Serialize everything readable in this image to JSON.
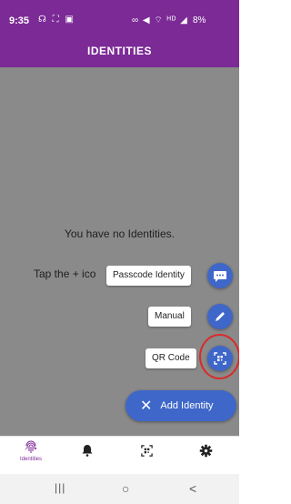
{
  "status_bar": {
    "time": "9:35",
    "left_icons": "☊ ⛶ ▣",
    "right_icons": "∞ ◀ ⌔ ᴴᴰ ◢",
    "battery": "8%"
  },
  "app_bar": {
    "title": "IDENTITIES"
  },
  "content": {
    "empty_title": "You have no Identities.",
    "empty_hint": "Tap the + ico"
  },
  "speed_dial": {
    "actions": [
      {
        "label": "Passcode Identity",
        "icon": "chat-bubble-icon"
      },
      {
        "label": "Manual",
        "icon": "pencil-icon"
      },
      {
        "label": "QR Code",
        "icon": "qr-scan-icon"
      }
    ],
    "main_label": "Add Identity",
    "main_icon": "close-icon"
  },
  "bottom_nav": {
    "items": [
      {
        "label": "Identities",
        "icon": "fingerprint-icon",
        "active": true
      },
      {
        "label": "",
        "icon": "bell-icon"
      },
      {
        "label": "",
        "icon": "qr-scan-icon"
      },
      {
        "label": "",
        "icon": "gear-icon"
      }
    ]
  },
  "system_nav": {
    "recent": "|||",
    "home": "○",
    "back": "<"
  },
  "colors": {
    "primary": "#7b2a96",
    "fab": "#3f67c9",
    "scrim": "#8a8a8a",
    "highlight": "#d92b2b"
  }
}
